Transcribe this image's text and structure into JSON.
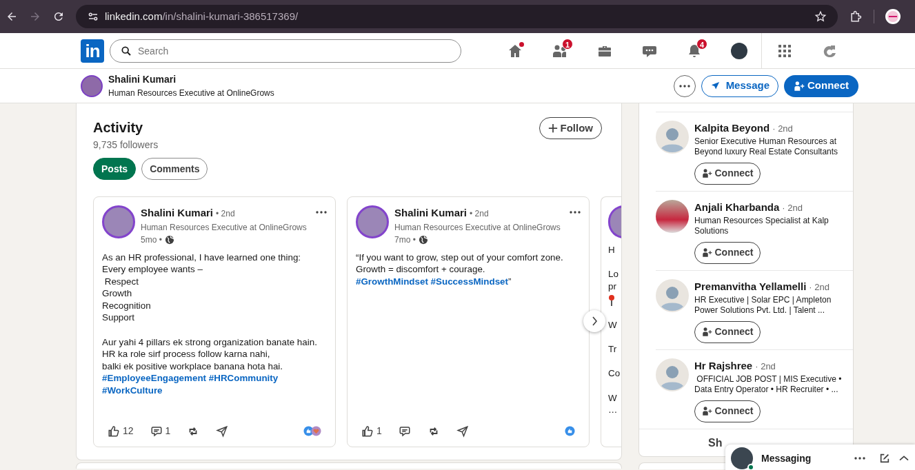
{
  "browser": {
    "url_host": "linkedin.com",
    "url_path": "/in/shalini-kumari-386517369/",
    "forward_disabled": true
  },
  "nav": {
    "logo_text": "in",
    "search_placeholder": "Search",
    "items": [
      {
        "kind": "home",
        "dot": true
      },
      {
        "kind": "network",
        "badge": "1"
      },
      {
        "kind": "jobs"
      },
      {
        "kind": "messaging"
      },
      {
        "kind": "notifications",
        "badge": "4"
      },
      {
        "kind": "me"
      },
      {
        "kind": "apps"
      },
      {
        "kind": "premium"
      }
    ]
  },
  "profile_bar": {
    "name": "Shalini Kumari",
    "headline": "Human Resources Executive at OnlineGrows",
    "message_label": "Message",
    "connect_label": "Connect"
  },
  "activity": {
    "title": "Activity",
    "followers": "9,735 followers",
    "follow_label": "Follow",
    "tabs": [
      {
        "label": "Posts",
        "selected": true
      },
      {
        "label": "Comments",
        "selected": false
      }
    ],
    "posts": [
      {
        "kind": "full",
        "author": "Shalini Kumari",
        "degree": "• 2nd",
        "headline": "Human Resources Executive at OnlineGrows",
        "age": "5mo •",
        "likes": "12",
        "comments": "1",
        "reactions": [
          {
            "kind": "like"
          },
          {
            "kind": "love"
          }
        ],
        "lines": [
          {
            "kind": "text",
            "segments": [
              {
                "text": "As an HR professional, I have learned one thing:",
                "hashtag": false
              }
            ]
          },
          {
            "kind": "text",
            "segments": [
              {
                "text": "Every employee wants –",
                "hashtag": false
              }
            ]
          },
          {
            "kind": "text",
            "segments": [
              {
                "text": " Respect",
                "hashtag": false
              }
            ]
          },
          {
            "kind": "text",
            "segments": [
              {
                "text": "Growth",
                "hashtag": false
              }
            ]
          },
          {
            "kind": "text",
            "segments": [
              {
                "text": "Recognition",
                "hashtag": false
              }
            ]
          },
          {
            "kind": "text",
            "segments": [
              {
                "text": "Support",
                "hashtag": false
              }
            ]
          },
          {
            "kind": "gap"
          },
          {
            "kind": "text",
            "segments": [
              {
                "text": "Aur yahi 4 pillars ek strong organization banate hain.",
                "hashtag": false
              }
            ]
          },
          {
            "kind": "text",
            "segments": [
              {
                "text": "HR ka role sirf process follow karna nahi,",
                "hashtag": false
              }
            ]
          },
          {
            "kind": "text",
            "segments": [
              {
                "text": "balki ek positive workplace banana hota hai.",
                "hashtag": false
              }
            ]
          },
          {
            "kind": "text",
            "segments": [
              {
                "text": "#EmployeeEngagement #HRCommunity #WorkCulture",
                "hashtag": true
              }
            ]
          }
        ]
      },
      {
        "kind": "full",
        "author": "Shalini Kumari",
        "degree": "• 2nd",
        "headline": "Human Resources Executive at OnlineGrows",
        "age": "7mo •",
        "likes": "1",
        "reactions": [
          {
            "kind": "like"
          }
        ],
        "lines": [
          {
            "kind": "text",
            "segments": [
              {
                "text": "“If you want to grow, step out of your comfort zone.",
                "hashtag": false
              }
            ]
          },
          {
            "kind": "text",
            "segments": [
              {
                "text": "Growth = discomfort + courage.",
                "hashtag": false
              }
            ]
          },
          {
            "kind": "text",
            "segments": [
              {
                "text": "#GrowthMindset #SuccessMindset",
                "hashtag": true
              },
              {
                "text": "”",
                "hashtag": false
              }
            ]
          }
        ]
      },
      {
        "kind": "clipped",
        "lines": [
          {
            "kind": "text",
            "segments": [
              {
                "text": "H",
                "hashtag": false
              }
            ]
          },
          {
            "kind": "gap"
          },
          {
            "kind": "text",
            "segments": [
              {
                "text": "Lo",
                "hashtag": false
              }
            ]
          },
          {
            "kind": "text",
            "segments": [
              {
                "text": "pr",
                "hashtag": false
              }
            ]
          },
          {
            "kind": "pin"
          },
          {
            "kind": "gap"
          },
          {
            "kind": "text",
            "segments": [
              {
                "text": "W",
                "hashtag": false
              }
            ]
          },
          {
            "kind": "gap"
          },
          {
            "kind": "text",
            "segments": [
              {
                "text": "Tr",
                "hashtag": false
              }
            ]
          },
          {
            "kind": "gap"
          },
          {
            "kind": "text",
            "segments": [
              {
                "text": "Co",
                "hashtag": false
              }
            ]
          },
          {
            "kind": "gap"
          },
          {
            "kind": "text",
            "segments": [
              {
                "text": "W",
                "hashtag": false
              }
            ]
          },
          {
            "kind": "text",
            "segments": [
              {
                "text": "…",
                "hashtag": false
              }
            ]
          }
        ]
      }
    ]
  },
  "people": {
    "items": [
      {
        "name": "Kalpita Beyond",
        "degree": "· 2nd",
        "headline": "Senior Executive Human Resources at Beyond luxury Real Estate Consultants",
        "kind": "placeholder",
        "connect_label": "Connect"
      },
      {
        "name": "Anjali Kharbanda",
        "degree": "· 2nd",
        "headline": "Human Resources Specialist at Kalp Solutions",
        "kind": "photo",
        "connect_label": "Connect"
      },
      {
        "name": "Premanvitha Yellamelli",
        "degree": "· 2nd",
        "headline": "HR Executive | Solar EPC | Ampleton Power Solutions Pvt. Ltd. | Talent ...",
        "kind": "placeholder",
        "connect_label": "Connect"
      },
      {
        "name": "Hr Rajshree",
        "degree": "· 2nd",
        "headline": " OFFICIAL JOB POST | MIS Executive • Data Entry Operator • HR Recruiter • ...",
        "kind": "placeholder",
        "connect_label": "Connect"
      }
    ],
    "show_all": "Sh"
  },
  "messaging": {
    "title": "Messaging",
    "online": true
  }
}
